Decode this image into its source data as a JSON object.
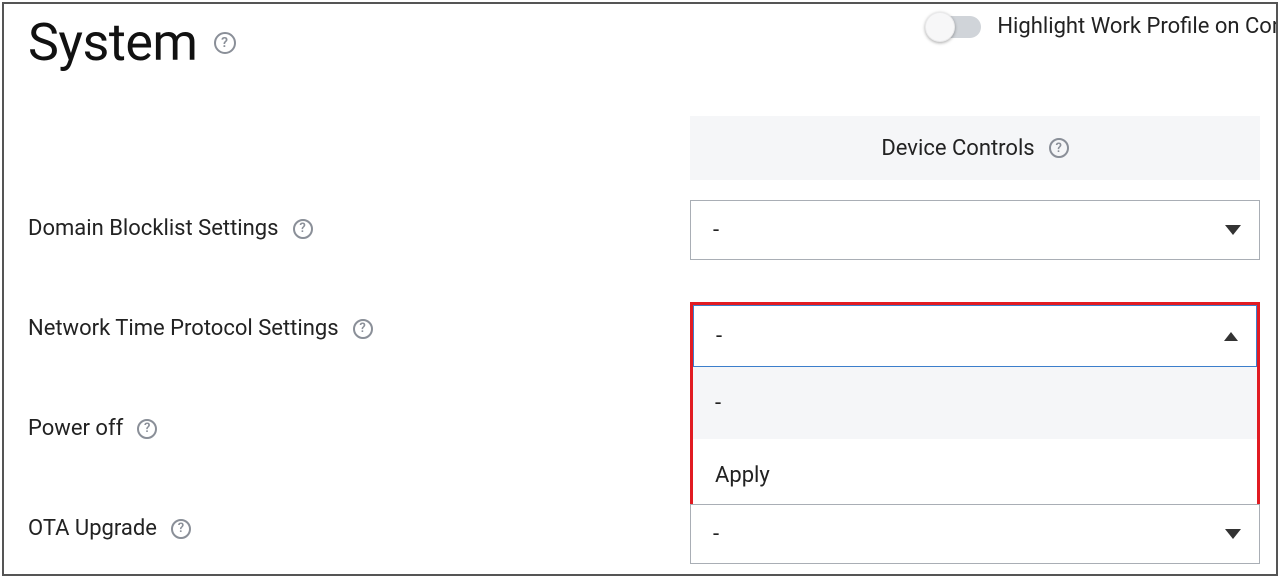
{
  "header": {
    "title": "System",
    "topRightToggleLabel": "Highlight Work Profile on Con",
    "topRightToggleOn": false
  },
  "rightPanel": {
    "deviceControlsLabel": "Device Controls"
  },
  "rows": {
    "domainBlocklist": {
      "label": "Domain Blocklist Settings",
      "selected": "-"
    },
    "ntp": {
      "label": "Network Time Protocol Settings",
      "selected": "-",
      "open": true,
      "options": [
        "-",
        "Apply"
      ]
    },
    "powerOff": {
      "label": "Power off"
    },
    "ota": {
      "label": "OTA Upgrade",
      "selected": "-"
    }
  },
  "colors": {
    "highlightBorder": "#e11b22",
    "focusBorder": "#3c7ecb",
    "panelBg": "#f5f6f8"
  }
}
